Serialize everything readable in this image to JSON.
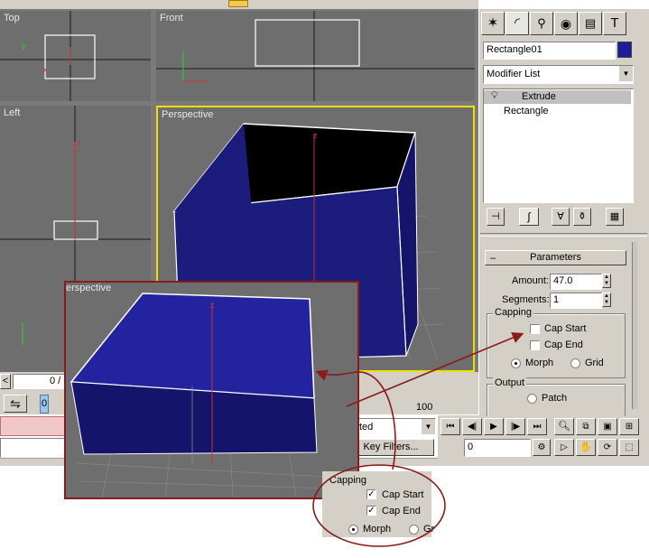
{
  "viewports": {
    "top": "Top",
    "front": "Front",
    "left": "Left",
    "perspective": "Perspective",
    "zoom_perspective": "erspective"
  },
  "axes": {
    "x": "x",
    "y": "y",
    "z": "z"
  },
  "command_panel": {
    "tab_icons": [
      "create-icon",
      "modify-icon",
      "hierarchy-icon",
      "motion-icon",
      "display-icon",
      "utilities-icon"
    ],
    "object_name": "Rectangle01",
    "object_color": "#1c1c9c",
    "modifier_list": "Modifier List",
    "stack": [
      "Extrude",
      "Rectangle"
    ]
  },
  "parameters": {
    "rollout_toggle": "–",
    "title": "Parameters",
    "amount_label": "Amount:",
    "amount_value": "47.0",
    "segments_label": "Segments:",
    "segments_value": "1",
    "capping_title": "Capping",
    "cap_start": "Cap Start",
    "cap_end": "Cap End",
    "morph": "Morph",
    "grid": "Grid",
    "output_title": "Output",
    "patch": "Patch"
  },
  "callout": {
    "capping_title": "Capping",
    "cap_start": "Cap Start",
    "cap_end": "Cap End",
    "morph": "Morph",
    "grid": "Gr",
    "check_mark": "✓"
  },
  "timeline": {
    "frame_display": "0 /",
    "current_frame": "0",
    "end_marker": "100",
    "selected_label": "ted",
    "key_filters": "Key Filters...",
    "frame_input": "0"
  },
  "colors": {
    "viewport_bg": "#6e6e6e",
    "box_blue": "#1c1c8a",
    "active_border": "#f0e000",
    "annotation": "#8b1a1a",
    "panel": "#d4d0c8"
  }
}
